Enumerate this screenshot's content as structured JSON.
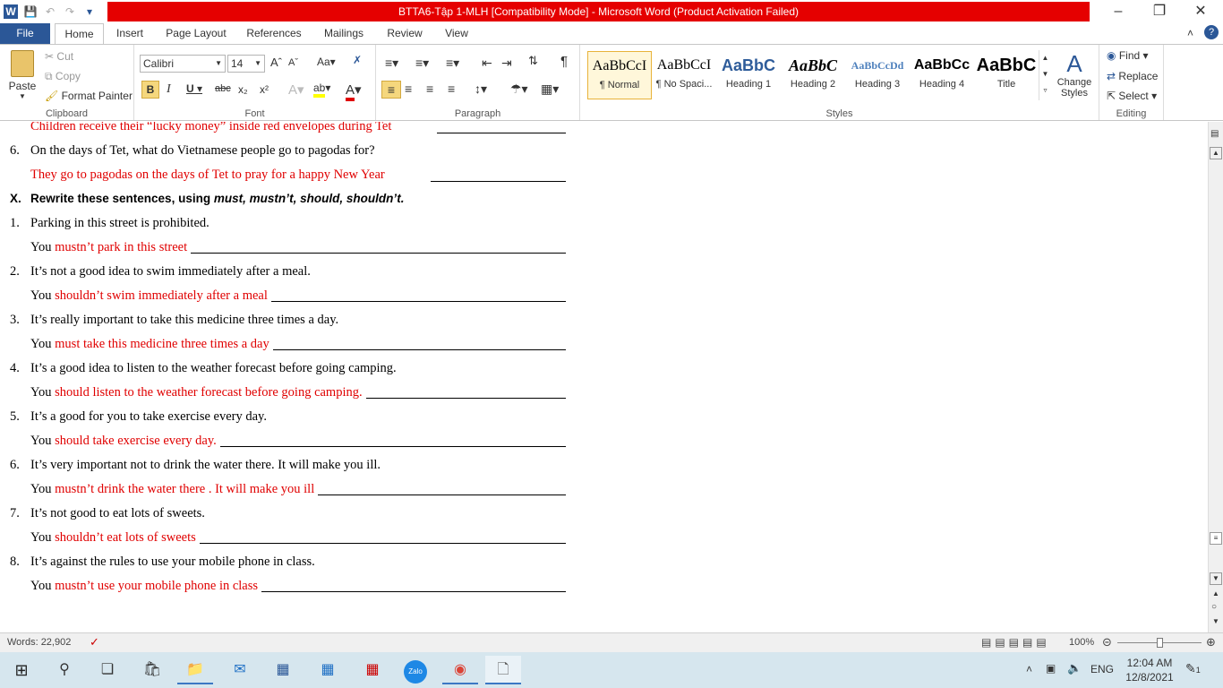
{
  "window": {
    "title": "BTTA6-Tập 1-MLH [Compatibility Mode]  -  Microsoft Word (Product Activation Failed)",
    "brand_color": "#e50000"
  },
  "tabs": [
    "File",
    "Home",
    "Insert",
    "Page Layout",
    "References",
    "Mailings",
    "Review",
    "View"
  ],
  "ribbon": {
    "clipboard": {
      "paste": "Paste",
      "cut": "Cut",
      "copy": "Copy",
      "format_painter": "Format Painter",
      "label": "Clipboard"
    },
    "font": {
      "family": "Calibri",
      "size": "14",
      "label": "Font"
    },
    "paragraph": {
      "label": "Paragraph"
    },
    "styles": {
      "label": "Styles",
      "items": [
        {
          "sample": "AaBbCcI",
          "name": "¶ Normal"
        },
        {
          "sample": "AaBbCcI",
          "name": "¶ No Spaci..."
        },
        {
          "sample": "AaBbC",
          "name": "Heading 1"
        },
        {
          "sample": "AaBbC",
          "name": "Heading 2"
        },
        {
          "sample": "AaBbCcDd",
          "name": "Heading 3"
        },
        {
          "sample": "AaBbCc",
          "name": "Heading 4"
        },
        {
          "sample": "AaBbC",
          "name": "Title"
        }
      ],
      "change_styles": "Change Styles"
    },
    "editing": {
      "find": "Find",
      "replace": "Replace",
      "select": "Select",
      "label": "Editing"
    }
  },
  "document": {
    "cut_line": "Children receive their “lucky money” inside red envelopes during Tet",
    "q6_num": "6.",
    "q6": "On the days of Tet, what do Vietnamese people go to pagodas for?",
    "a6": "They go to pagodas on the days of Tet to pray for a happy New Year",
    "section_num": "X.",
    "section_prefix": "Rewrite these sentences, using ",
    "section_words": "must, mustn’t, should, shouldn’t.",
    "items": [
      {
        "num": "1.",
        "q": "Parking in this street is prohibited.",
        "you": "You",
        "a": "mustn’t park in this street"
      },
      {
        "num": "2.",
        "q": "It’s not a good idea to swim immediately after a meal.",
        "you": "You",
        "a": "shouldn’t swim immediately after a meal"
      },
      {
        "num": "3.",
        "q": "It’s really important to take this medicine three times a day.",
        "you": "You",
        "a": "must take this medicine three times a day"
      },
      {
        "num": "4.",
        "q": "It’s a good idea to listen to the weather forecast before going camping.",
        "you": "You",
        "a": "should listen to the weather forecast before going camping."
      },
      {
        "num": "5.",
        "q": "It’s a good for you to take exercise every day.",
        "you": "You",
        "a": "should take exercise every day."
      },
      {
        "num": "6.",
        "q": "It’s very important not to drink the water there. It will make you ill.",
        "you": "You",
        "a": "mustn’t drink the water there . It will make you ill"
      },
      {
        "num": "7.",
        "q": "It’s not good to eat lots of sweets.",
        "you": "You",
        "a": "shouldn’t eat lots of sweets"
      },
      {
        "num": "8.",
        "q": "It’s against the rules to use your mobile phone in class.",
        "you": "You",
        "a": "mustn’t use your mobile phone in class"
      }
    ]
  },
  "status": {
    "words": "Words: 22,902",
    "zoom": "100%"
  },
  "taskbar": {
    "lang": "ENG",
    "time": "12:04 AM",
    "date": "12/8/2021",
    "notifications": "1"
  }
}
